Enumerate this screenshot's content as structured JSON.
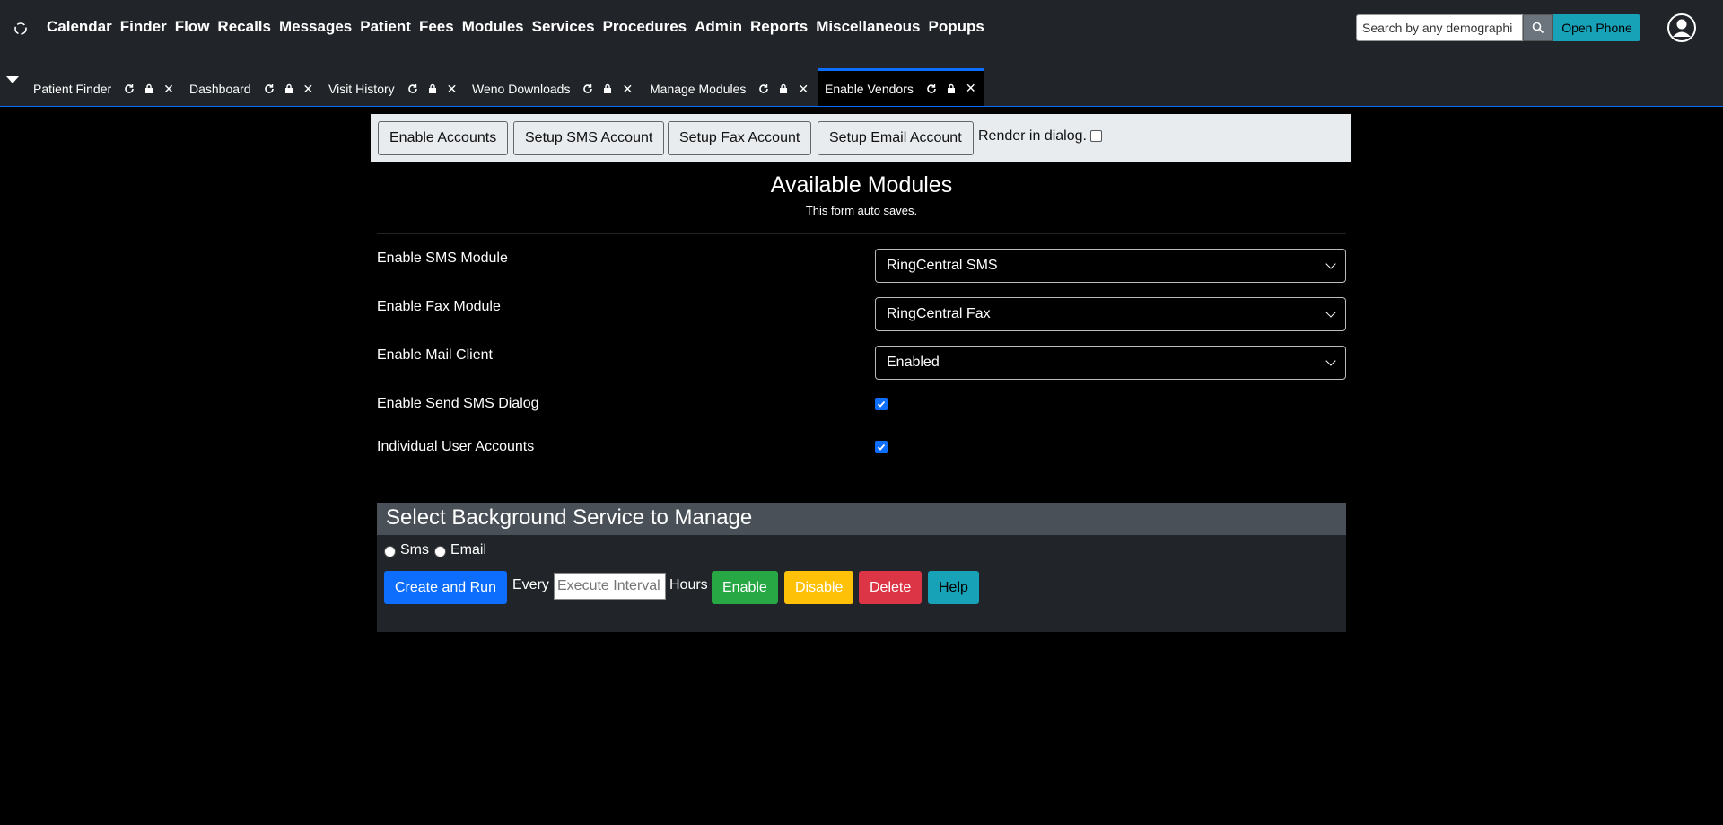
{
  "nav": {
    "menu": [
      "Calendar",
      "Finder",
      "Flow",
      "Recalls",
      "Messages",
      "Patient",
      "Fees",
      "Modules",
      "Services",
      "Procedures",
      "Admin",
      "Reports",
      "Miscellaneous",
      "Popups"
    ],
    "search_value": "Search by any demographi",
    "open_phone_label": "Open Phone"
  },
  "tabs": [
    {
      "label": "Patient Finder"
    },
    {
      "label": "Dashboard"
    },
    {
      "label": "Visit History"
    },
    {
      "label": "Weno Downloads"
    },
    {
      "label": "Manage Modules"
    },
    {
      "label": "Enable Vendors",
      "active": true
    }
  ],
  "account_bar": {
    "enable_accounts": "Enable Accounts",
    "setup_sms": "Setup SMS Account",
    "setup_fax": "Setup Fax Account",
    "setup_email": "Setup Email Account",
    "render_in_dialog": "Render in dialog."
  },
  "modules": {
    "title": "Available Modules",
    "subtitle": "This form auto saves.",
    "sms_label": "Enable SMS Module",
    "sms_value": "RingCentral SMS",
    "fax_label": "Enable Fax Module",
    "fax_value": "RingCentral Fax",
    "mail_label": "Enable Mail Client",
    "mail_value": "Enabled",
    "send_sms_dialog_label": "Enable Send SMS Dialog",
    "send_sms_dialog_checked": true,
    "individual_accounts_label": "Individual User Accounts",
    "individual_accounts_checked": true
  },
  "background": {
    "header": "Select Background Service to Manage",
    "radio_sms": "Sms",
    "radio_email": "Email",
    "create_run": "Create and Run",
    "every": "Every",
    "interval_placeholder": "Execute Interval",
    "hours": "Hours",
    "enable": "Enable",
    "disable": "Disable",
    "delete": "Delete",
    "help": "Help"
  },
  "colors": {
    "primary": "#0d6efd",
    "success": "#28a745",
    "warning": "#ffc107",
    "danger": "#dc3545",
    "info": "#17a2b8",
    "navbar": "#212529"
  }
}
